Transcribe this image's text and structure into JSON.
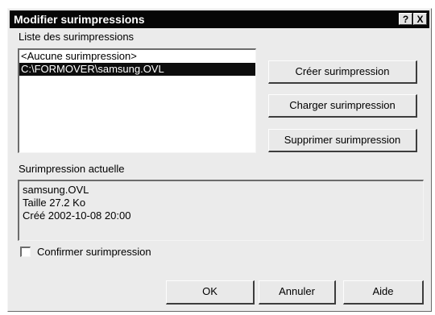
{
  "window": {
    "title": "Modifier surimpressions",
    "help_glyph": "?",
    "close_glyph": "X"
  },
  "list": {
    "label": "Liste des surimpressions",
    "items": [
      {
        "text": "<Aucune surimpression>",
        "selected": false
      },
      {
        "text": "C:\\FORMOVER\\samsung.OVL",
        "selected": true
      }
    ]
  },
  "actions": {
    "create_label": "Créer surimpression",
    "load_label": "Charger surimpression",
    "delete_label": "Supprimer surimpression"
  },
  "current": {
    "label": "Surimpression actuelle",
    "name": "samsung.OVL",
    "size": "Taille 27.2 Ko",
    "created": "Créé 2002-10-08 20:00"
  },
  "confirm": {
    "label": "Confirmer surimpression",
    "checked": false
  },
  "footer": {
    "ok_label": "OK",
    "cancel_label": "Annuler",
    "help_label": "Aide"
  }
}
